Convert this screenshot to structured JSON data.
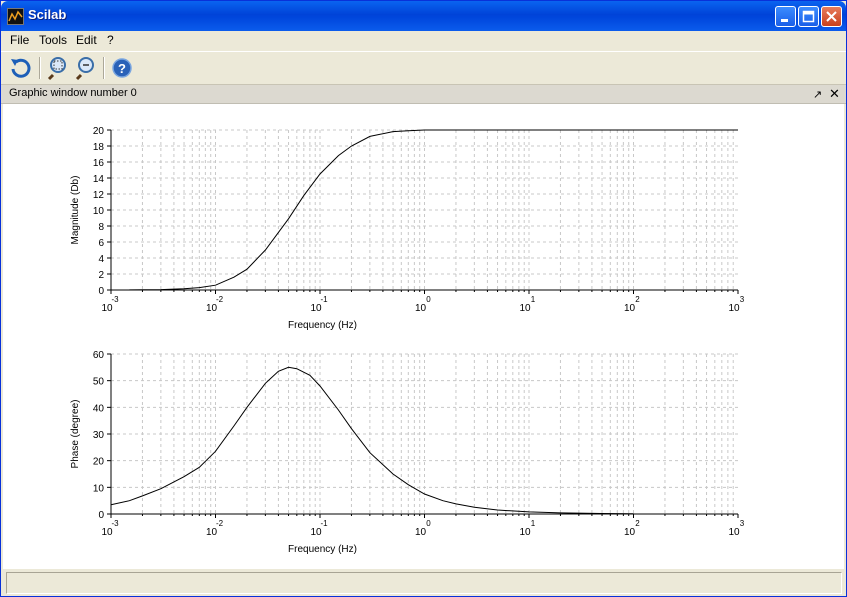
{
  "window": {
    "title": "Scilab"
  },
  "menu": {
    "file": "File",
    "tools": "Tools",
    "edit": "Edit",
    "help": "?"
  },
  "toolbar": {
    "icons": [
      "rotate-icon",
      "zoom-icon",
      "unzoom-icon",
      "help-icon"
    ]
  },
  "panel": {
    "title": "Graphic window number 0",
    "undock_glyph": "↗",
    "close_glyph": "✕"
  },
  "status": {
    "text": ""
  },
  "colors": {
    "titlebar": "#0046dc",
    "window_bg": "#ece9d8",
    "grid": "#c8c8c8",
    "curve": "#000000"
  },
  "chart_data": [
    {
      "type": "line",
      "title": "",
      "xlabel": "Frequency (Hz)",
      "ylabel": "Magnitude (Db)",
      "xscale": "log",
      "xlim": [
        0.001,
        1000
      ],
      "ylim": [
        0,
        20
      ],
      "yticks": [
        0,
        2,
        4,
        6,
        8,
        10,
        12,
        14,
        16,
        18,
        20
      ],
      "xtick_exponents": [
        "-3",
        "-2",
        "-1",
        "0",
        "1",
        "2",
        "3"
      ],
      "xtick_base": "10",
      "grid": true,
      "series": [
        {
          "x": [
            0.0015,
            0.002,
            0.003,
            0.005,
            0.007,
            0.01,
            0.015,
            0.02,
            0.03,
            0.05,
            0.07,
            0.1,
            0.15,
            0.2,
            0.3,
            0.5,
            0.7,
            1,
            1.5,
            2,
            3,
            5,
            10,
            100,
            1000
          ],
          "values": [
            0.01,
            0.02,
            0.05,
            0.15,
            0.3,
            0.6,
            1.6,
            2.6,
            5.0,
            8.9,
            11.8,
            14.5,
            16.8,
            18.0,
            19.2,
            19.8,
            19.9,
            20.0,
            20.0,
            20.0,
            20.0,
            20.0,
            20.0,
            20.0,
            20.0
          ]
        }
      ]
    },
    {
      "type": "line",
      "title": "",
      "xlabel": "Frequency (Hz)",
      "ylabel": "Phase (degree)",
      "xscale": "log",
      "xlim": [
        0.001,
        1000
      ],
      "ylim": [
        0,
        60
      ],
      "yticks": [
        0,
        10,
        20,
        30,
        40,
        50,
        60
      ],
      "xtick_exponents": [
        "-3",
        "-2",
        "-1",
        "0",
        "1",
        "2",
        "3"
      ],
      "xtick_base": "10",
      "grid": true,
      "series": [
        {
          "x": [
            0.001,
            0.0015,
            0.002,
            0.003,
            0.005,
            0.007,
            0.01,
            0.015,
            0.02,
            0.03,
            0.04,
            0.05,
            0.06,
            0.08,
            0.1,
            0.15,
            0.2,
            0.3,
            0.5,
            0.7,
            1,
            1.5,
            2,
            3,
            5,
            10,
            20,
            50,
            100
          ],
          "values": [
            3.5,
            5.0,
            6.8,
            9.5,
            14.0,
            17.5,
            23.5,
            33.0,
            40.0,
            49.0,
            53.5,
            55.0,
            54.5,
            52.0,
            48.0,
            39.0,
            32.0,
            23.0,
            15.0,
            11.0,
            7.5,
            5.0,
            3.8,
            2.5,
            1.5,
            0.8,
            0.4,
            0.2,
            0.1
          ]
        }
      ]
    }
  ]
}
